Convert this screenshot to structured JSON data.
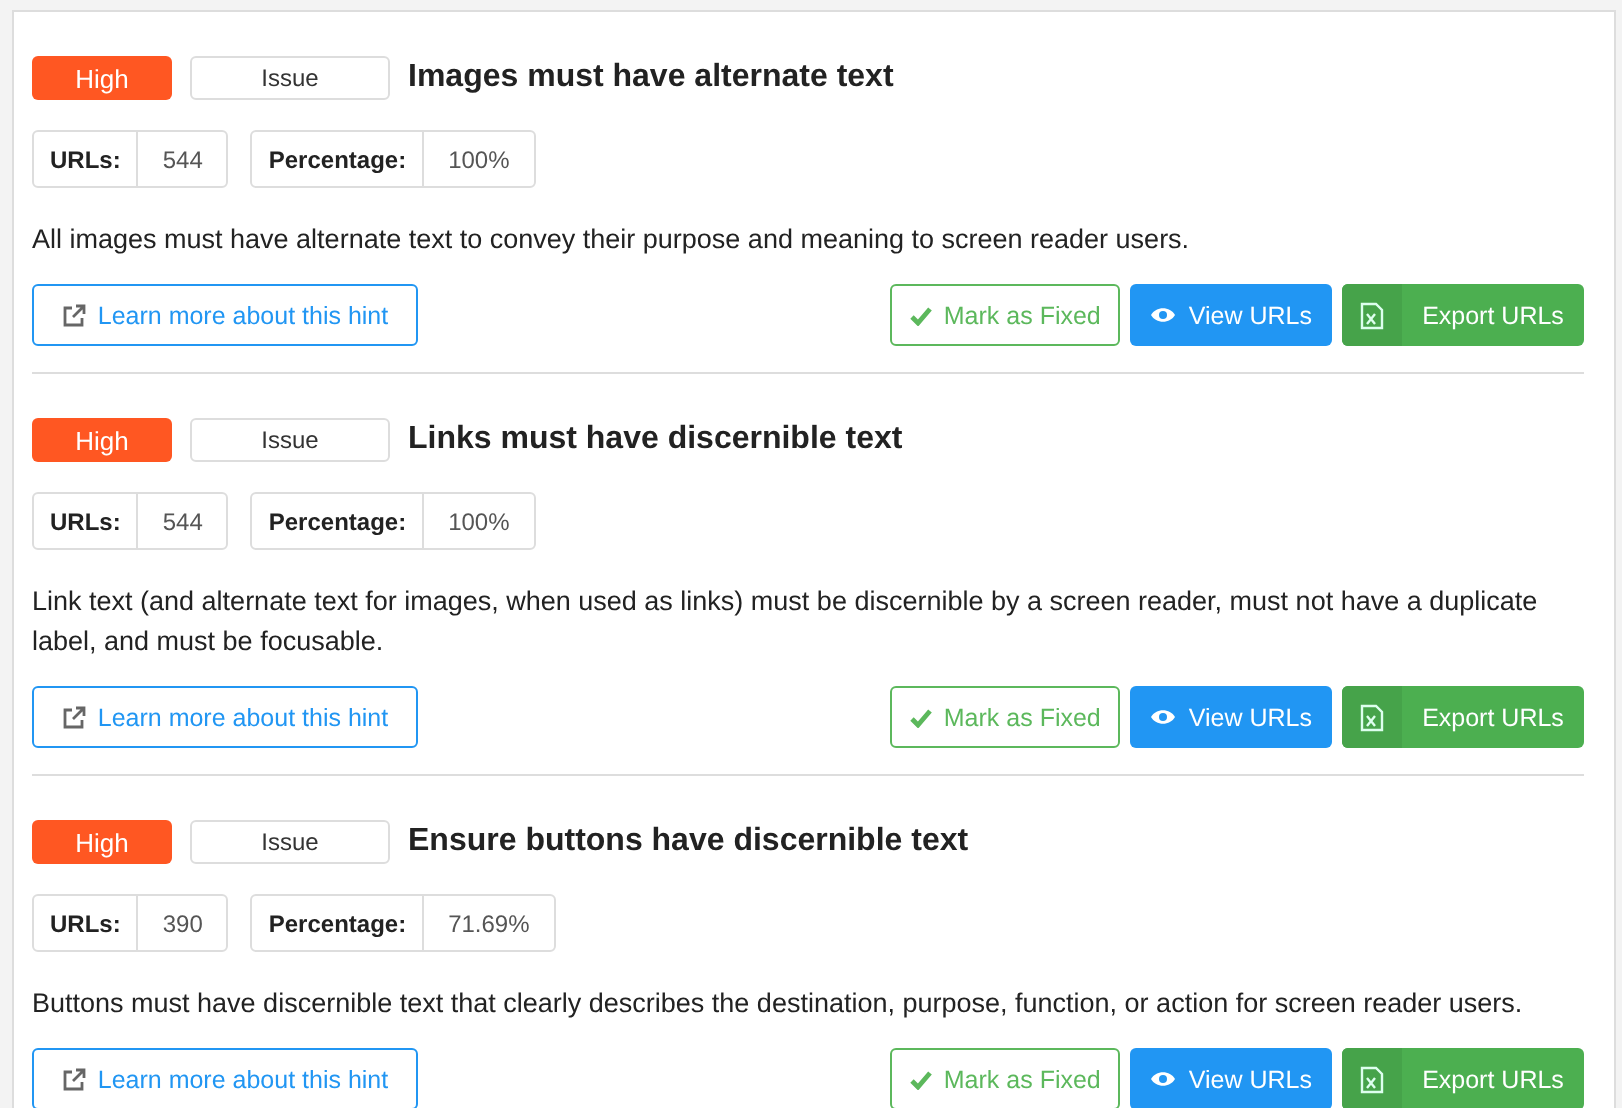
{
  "hints": [
    {
      "severity": "High",
      "type": "Issue",
      "title": "Images must have alternate text",
      "urls_label": "URLs:",
      "urls": "544",
      "percentage_label": "Percentage:",
      "percentage": "100%",
      "description": "All images must have alternate text to convey their purpose and meaning to screen reader users.",
      "learn_more": "Learn more about this hint",
      "mark_fixed": "Mark as Fixed",
      "view": "View URLs",
      "export": "Export URLs"
    },
    {
      "severity": "High",
      "type": "Issue",
      "title": "Links must have discernible text",
      "urls_label": "URLs:",
      "urls": "544",
      "percentage_label": "Percentage:",
      "percentage": "100%",
      "description": "Link text (and alternate text for images, when used as links) must be discernible by a screen reader, must not have a duplicate label, and must be focusable.",
      "learn_more": "Learn more about this hint",
      "mark_fixed": "Mark as Fixed",
      "view": "View URLs",
      "export": "Export URLs"
    },
    {
      "severity": "High",
      "type": "Issue",
      "title": "Ensure buttons have discernible text",
      "urls_label": "URLs:",
      "urls": "390",
      "percentage_label": "Percentage:",
      "percentage": "71.69%",
      "description": "Buttons must have discernible text that clearly describes the destination, purpose, function, or action for screen reader users.",
      "learn_more": "Learn more about this hint",
      "mark_fixed": "Mark as Fixed",
      "view": "View URLs",
      "export": "Export URLs"
    }
  ]
}
